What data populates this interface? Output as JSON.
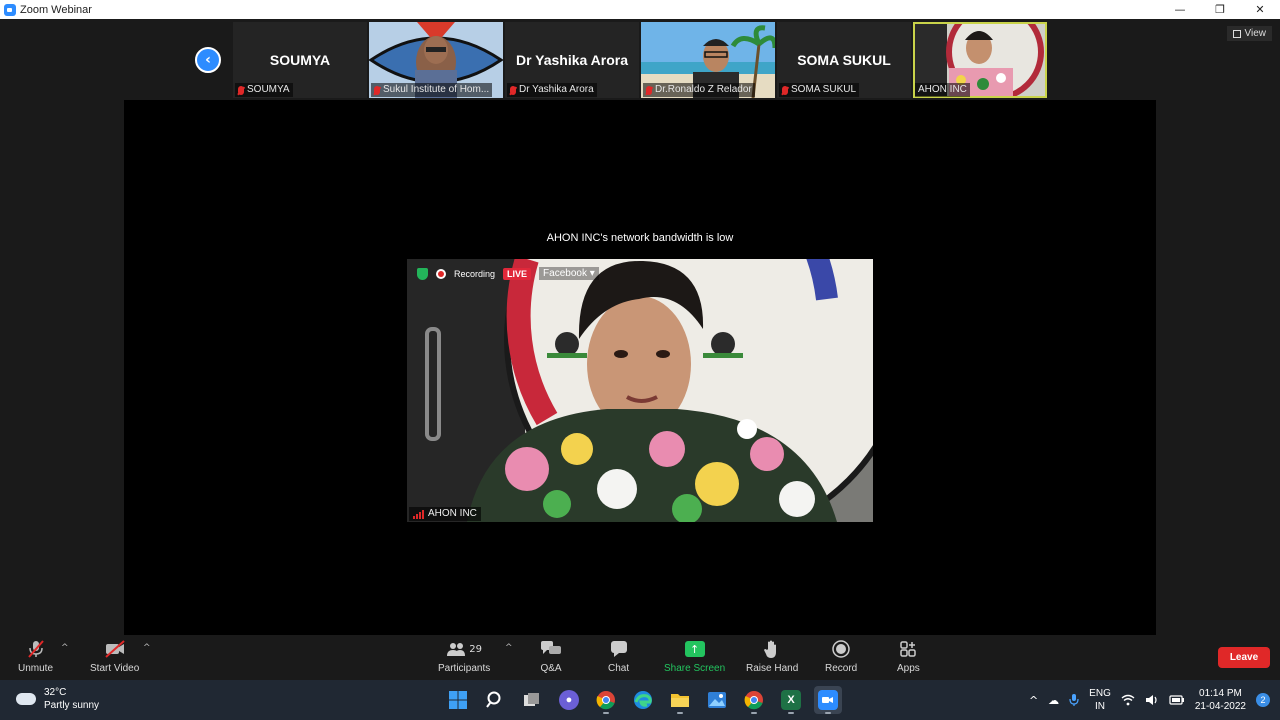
{
  "window": {
    "title": "Zoom Webinar",
    "controls": [
      "—",
      "❐",
      "✕"
    ]
  },
  "thumbnails": [
    {
      "big_name": "SOUMYA",
      "caption": "SOUMYA",
      "muted": true,
      "video": false
    },
    {
      "big_name": "",
      "caption": "Sukul Institute of Hom...",
      "muted": true,
      "video": true
    },
    {
      "big_name": "Dr Yashika Arora",
      "caption": "Dr Yashika Arora",
      "muted": true,
      "video": false
    },
    {
      "big_name": "",
      "caption": "Dr.Ronaldo Z Relador",
      "muted": true,
      "video": true
    },
    {
      "big_name": "SOMA SUKUL",
      "caption": "SOMA SUKUL",
      "muted": true,
      "video": false
    },
    {
      "big_name": "",
      "caption": "AHON INC",
      "muted": false,
      "video": true,
      "active": true
    }
  ],
  "view_button": "View",
  "stage": {
    "notice": "AHON INC's network bandwidth is low",
    "recording_label": "Recording",
    "live_label": "LIVE",
    "stream_target": "Facebook",
    "speaker_name": "AHON INC"
  },
  "toolbar": {
    "unmute": "Unmute",
    "start_video": "Start Video",
    "participants": "Participants",
    "participant_count": "29",
    "qa": "Q&A",
    "chat": "Chat",
    "share_screen": "Share Screen",
    "raise_hand": "Raise Hand",
    "record": "Record",
    "apps": "Apps",
    "leave": "Leave"
  },
  "taskbar": {
    "temperature": "32°C",
    "weather": "Partly sunny",
    "lang_top": "ENG",
    "lang_bottom": "IN",
    "time": "01:14 PM",
    "date": "21-04-2022",
    "notifications": "2",
    "excel_glyph": "X"
  },
  "colors": {
    "accent": "#2d8cff",
    "leave": "#e02828",
    "share": "#23c45f",
    "live": "#e0283a"
  }
}
